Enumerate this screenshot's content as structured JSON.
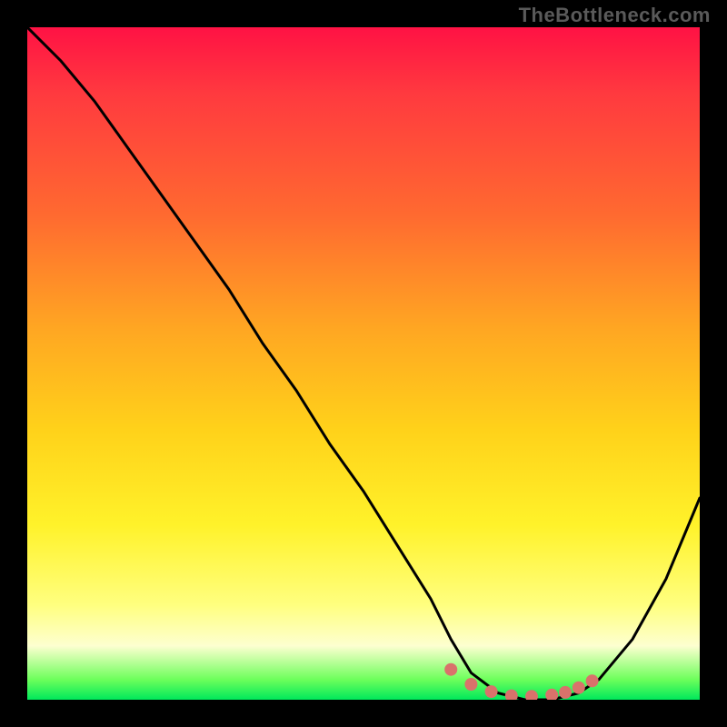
{
  "watermark": {
    "text": "TheBottleneck.com"
  },
  "chart_data": {
    "type": "line",
    "title": "",
    "xlabel": "",
    "ylabel": "",
    "xlim": [
      0,
      100
    ],
    "ylim": [
      0,
      100
    ],
    "series": [
      {
        "name": "bottleneck-curve",
        "x": [
          0,
          5,
          10,
          15,
          20,
          25,
          30,
          35,
          40,
          45,
          50,
          55,
          60,
          63,
          66,
          70,
          74,
          78,
          82,
          85,
          90,
          95,
          100
        ],
        "y": [
          100,
          95,
          89,
          82,
          75,
          68,
          61,
          53,
          46,
          38,
          31,
          23,
          15,
          9,
          4,
          1,
          0,
          0,
          1,
          3,
          9,
          18,
          30
        ]
      }
    ],
    "markers": {
      "name": "highlight-dots",
      "color": "#d9726b",
      "x": [
        63,
        66,
        69,
        72,
        75,
        78,
        80,
        82,
        84
      ],
      "y": [
        4.5,
        2.3,
        1.2,
        0.6,
        0.5,
        0.7,
        1.1,
        1.8,
        2.8
      ]
    },
    "gradient_stops": [
      {
        "pos": 0,
        "color": "#ff1244"
      },
      {
        "pos": 10,
        "color": "#ff3a3f"
      },
      {
        "pos": 28,
        "color": "#ff6a30"
      },
      {
        "pos": 45,
        "color": "#ffa722"
      },
      {
        "pos": 60,
        "color": "#ffd21a"
      },
      {
        "pos": 74,
        "color": "#fff22a"
      },
      {
        "pos": 86,
        "color": "#ffff80"
      },
      {
        "pos": 92,
        "color": "#fdffd0"
      },
      {
        "pos": 97,
        "color": "#6dff5b"
      },
      {
        "pos": 100,
        "color": "#00e85b"
      }
    ]
  }
}
